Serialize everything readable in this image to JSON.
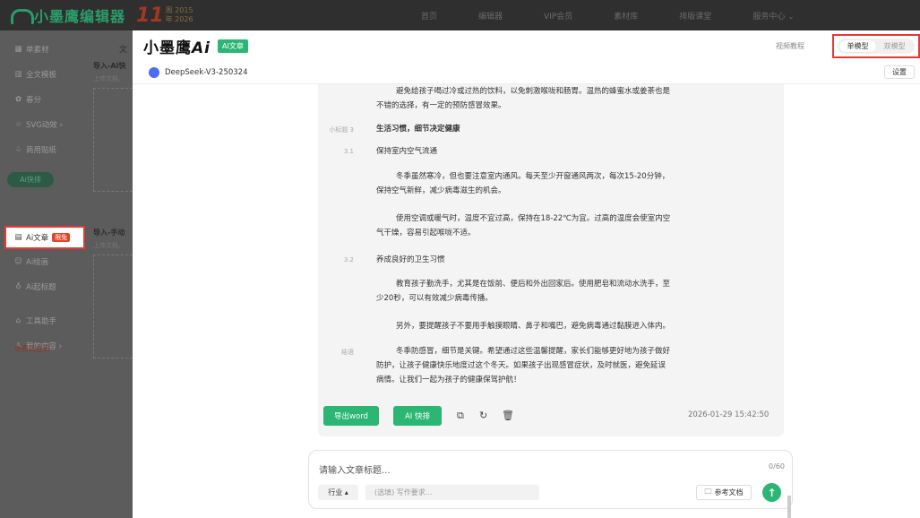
{
  "topbar": {
    "logo_text": "小墨鹰编辑器",
    "anniversary": {
      "number": "11",
      "line1": "周 2015",
      "line2": "年 2026"
    },
    "nav": [
      "首页",
      "编辑器",
      "VIP会员",
      "素材库",
      "排版课堂",
      "服务中心 ⌄"
    ]
  },
  "sidebar": {
    "items": [
      {
        "icon": "▦",
        "label": "单素材"
      },
      {
        "icon": "▥",
        "label": "全文模板"
      },
      {
        "icon": "✿",
        "label": "春分"
      },
      {
        "icon": "☆",
        "label": "SVG动效 ›"
      },
      {
        "icon": "♤",
        "label": "商用贴纸"
      }
    ],
    "ai_quick": "Ai快排",
    "ai_article": "Ai文章",
    "ai_article_badge": "限免",
    "items2": [
      {
        "icon": "☺",
        "label": "Ai绘画"
      },
      {
        "icon": "♁",
        "label": "Ai起标题"
      },
      {
        "icon": "⌂",
        "label": "工具助手"
      },
      {
        "icon": "♙",
        "label": "我的内容 ›"
      }
    ],
    "vip": "免费领会员"
  },
  "dimcol": {
    "w": "文",
    "t1": "导入-AI快",
    "s1": "上传文档,",
    "t2": "导入-手动",
    "s2": "上传文档,"
  },
  "modal": {
    "brand": "小墨鹰",
    "brand_ai": "Ai",
    "tag": "AI文章",
    "video_tutorial": "视频教程",
    "model_single": "单模型",
    "model_double": "双模型",
    "model_name": "DeepSeek-V3-250324",
    "settings": "设置"
  },
  "article": {
    "p_top": "避免给孩子喝过冷或过热的饮料，以免刺激喉咙和肠胃。温热的蜂蜜水或姜茶也是",
    "p_top2": "不错的选择，有一定的预防感冒效果。",
    "h3_label": "小标题 3",
    "h3": "生活习惯，细节决定健康",
    "s31_label": "3.1",
    "s31": "保持室内空气流通",
    "p1a": "冬季虽然寒冷，但也要注意室内通风。每天至少开窗通风两次，每次15-20分钟，",
    "p1b": "保持空气新鲜，减少病毒滋生的机会。",
    "p2a": "使用空调或暖气时，温度不宜过高，保持在18-22℃为宜。过高的温度会使室内空",
    "p2b": "气干燥，容易引起喉咙不适。",
    "s32_label": "3.2",
    "s32": "养成良好的卫生习惯",
    "p3a": "教育孩子勤洗手，尤其是在饭前、便后和外出回家后。使用肥皂和流动水洗手，至",
    "p3b": "少20秒，可以有效减少病毒传播。",
    "p4": "另外，要提醒孩子不要用手触摸眼睛、鼻子和嘴巴，避免病毒通过黏膜进入体内。",
    "end_label": "结语",
    "p5a": "冬季防感冒，细节是关键。希望通过这些温馨提醒，家长们能够更好地为孩子做好",
    "p5b": "防护，让孩子健康快乐地度过这个冬天。如果孩子出现感冒症状，及时就医，避免延误",
    "p5c": "病情。让我们一起为孩子的健康保驾护航！",
    "export_word": "导出word",
    "ai_layout": "AI 快排",
    "timestamp": "2026-01-29 15:42:50"
  },
  "input": {
    "title_placeholder": "请输入文章标题...",
    "count": "0/60",
    "industry": "行业 ▴",
    "requirement_placeholder": "(选填) 写作要求...",
    "reference": "参考文档"
  }
}
